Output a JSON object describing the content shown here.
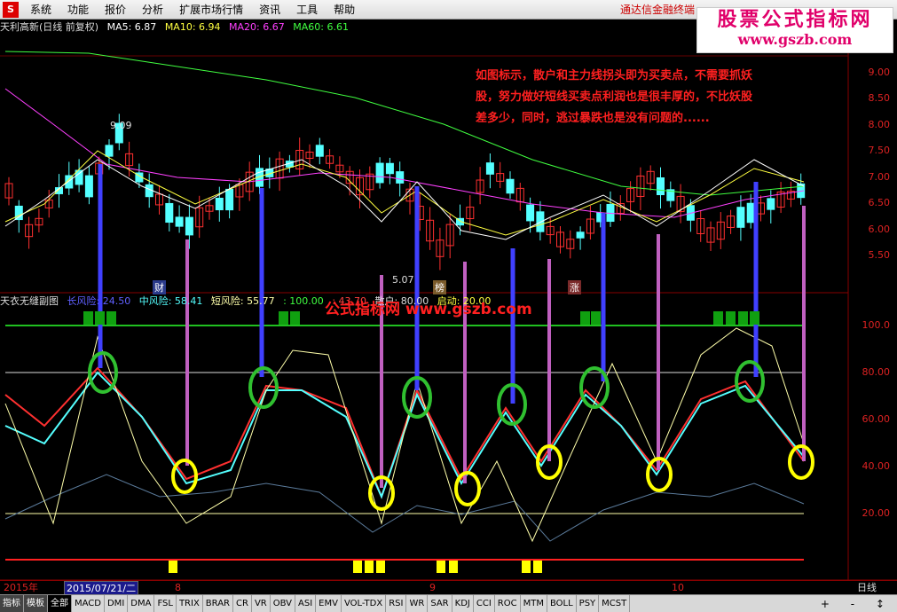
{
  "menu": {
    "items": [
      "系统",
      "功能",
      "报价",
      "分析",
      "扩展市场行情",
      "资讯",
      "工具",
      "帮助"
    ],
    "brand": "通达信金融终端"
  },
  "watermark_logo": {
    "line1": "股票公式指标网",
    "line2": "www.gszb.com"
  },
  "main_legend": {
    "title": "天利高新(日线 前复权)",
    "ma5": "MA5: 6.87",
    "ma10": "MA10: 6.94",
    "ma20": "MA20: 6.67",
    "ma60": "MA60: 6.61"
  },
  "price_axis": [
    "9.00",
    "8.50",
    "8.00",
    "7.50",
    "7.00",
    "6.50",
    "6.00",
    "5.50"
  ],
  "price_markers": {
    "high": "9.09",
    "low": "5.07"
  },
  "chart_tags": [
    "财",
    "榜",
    "涨"
  ],
  "annotation": "如图标示，散户和主力线拐头即为买卖点，不需要抓妖股，努力做好短线买卖点利润也是很丰厚的，不比妖股差多少，同时，逃过暴跌也是没有问题的......",
  "sub_legend": {
    "title": "天衣无缝副图",
    "long": "长风险: 24.50",
    "mid": "中风险: 58.41",
    "short": "短风险: 55.77",
    "v100": ": 100.00",
    "v1": ": 43.70",
    "v2": "散户: 80.00",
    "v3": "启动: 20.00"
  },
  "sub_watermark": "公式指标网 www.gszb.com",
  "sub_axis": [
    "100.0",
    "80.00",
    "60.00",
    "40.00",
    "20.00"
  ],
  "date_bar": {
    "year": "2015年",
    "current": "2015/07/21/二",
    "m8": "8",
    "m9": "9",
    "m10": "10",
    "period": "日线"
  },
  "tabs": [
    "指标",
    "模板",
    "全部",
    "MACD",
    "DMI",
    "DMA",
    "FSL",
    "TRIX",
    "BRAR",
    "CR",
    "VR",
    "OBV",
    "ASI",
    "EMV",
    "VOL-TDX",
    "RSI",
    "WR",
    "SAR",
    "KDJ",
    "CCI",
    "ROC",
    "MTM",
    "BOLL",
    "PSY",
    "MCST"
  ],
  "tab_controls": "+ - ↕",
  "colors": {
    "up": "#ff3030",
    "down": "#54ffff",
    "ma5": "#ffffff",
    "ma10": "#ffff40",
    "ma20": "#ff40ff",
    "ma60": "#40ff40",
    "buy": "#4040ff",
    "sell": "#c060c0",
    "green_circle": "#30c030",
    "yellow_circle": "#ffff00"
  }
}
